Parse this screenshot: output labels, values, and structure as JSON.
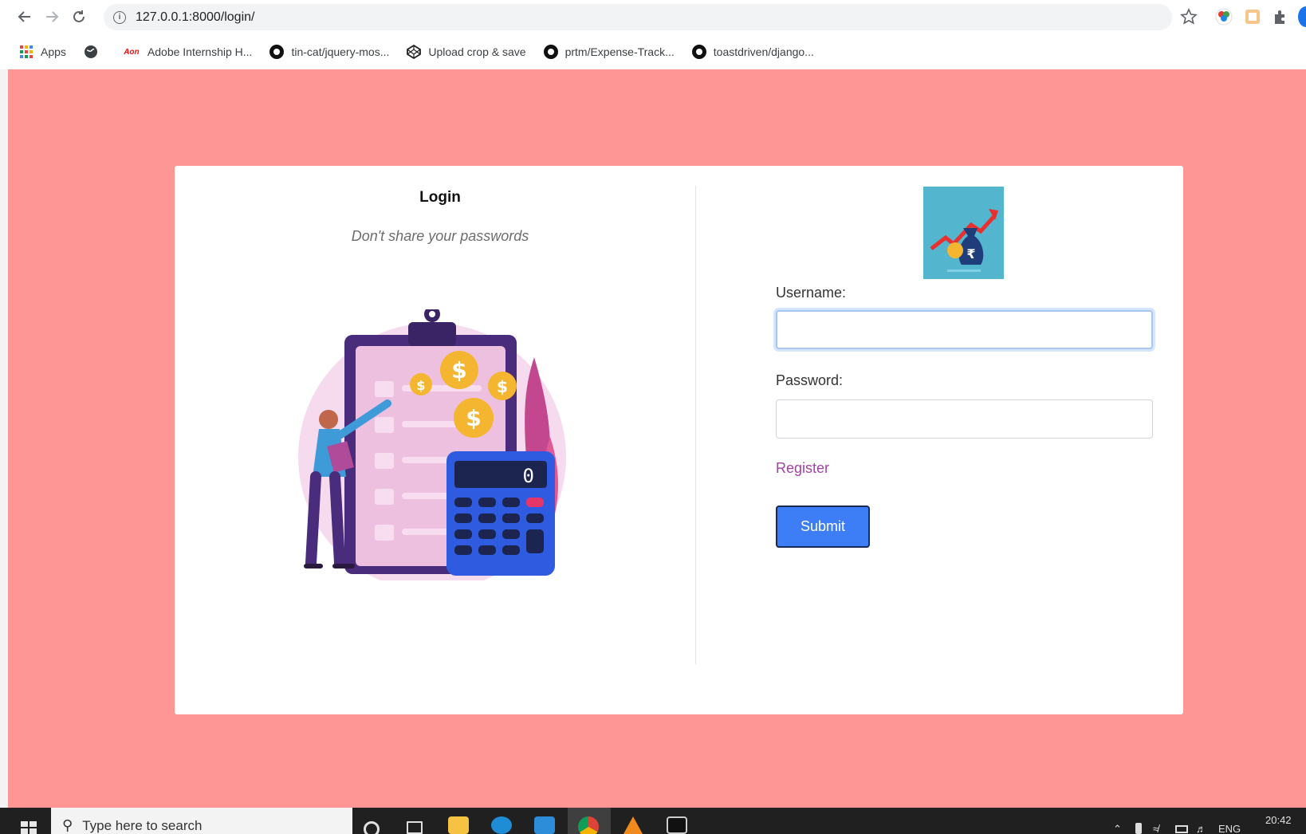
{
  "browser": {
    "url": "127.0.0.1:8000/login/",
    "bookmarks": [
      {
        "label": "Apps",
        "icon": "apps-grid-icon"
      },
      {
        "label": "",
        "icon": "globe-icon"
      },
      {
        "label": "Adobe Internship H...",
        "icon": "aon-icon"
      },
      {
        "label": "tin-cat/jquery-mos...",
        "icon": "github-icon"
      },
      {
        "label": "Upload crop & save",
        "icon": "codepen-icon"
      },
      {
        "label": "prtm/Expense-Track...",
        "icon": "github-icon"
      },
      {
        "label": "toastdriven/django...",
        "icon": "github-icon"
      }
    ]
  },
  "page": {
    "background_color": "#ff9696",
    "left": {
      "title": "Login",
      "subtitle": "Don't share your passwords",
      "illustration": "clipboard-calculator-illustration"
    },
    "form": {
      "username_label": "Username:",
      "username_value": "",
      "password_label": "Password:",
      "password_value": "",
      "register_link": "Register",
      "submit_label": "Submit",
      "logo": "rupee-growth-logo"
    }
  },
  "taskbar": {
    "search_placeholder": "Type here to search",
    "language": "ENG",
    "time": "20:42"
  }
}
